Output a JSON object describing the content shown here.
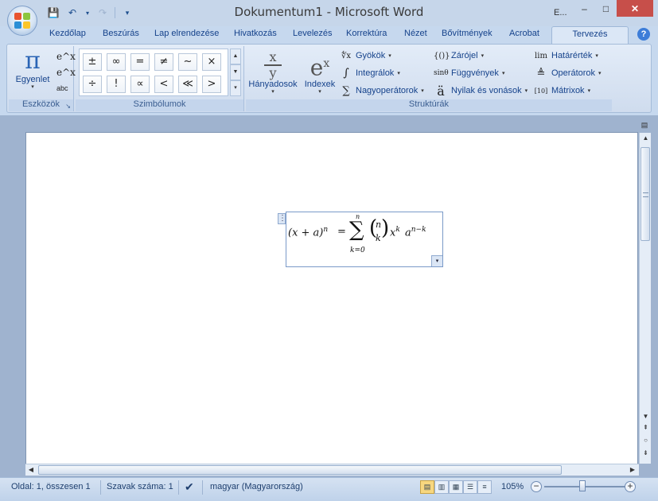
{
  "window": {
    "title": "Dokumentum1 - Microsoft Word",
    "user": "E...",
    "minimize": "–",
    "maximize": "□",
    "close": "✕"
  },
  "qat": {
    "save": "💾",
    "undo": "↶",
    "undo_dd": "▾",
    "redo": "↷",
    "customize": "▾"
  },
  "tabs": [
    "Kezdőlap",
    "Beszúrás",
    "Lap elrendezése",
    "Hivatkozás",
    "Levelezés",
    "Korrektúra",
    "Nézet",
    "Bővítmények",
    "Acrobat",
    "Tervezés"
  ],
  "active_tab": "Tervezés",
  "help": "?",
  "ribbon": {
    "eszkozok": {
      "label": "Eszközök",
      "launcher": "↘",
      "equation_glyph": "π",
      "equation_label": "Egyenlet",
      "equation_caret": "▾",
      "small_icons": [
        "e^x",
        "e^x",
        "abc"
      ]
    },
    "szimbolumok": {
      "label": "Szimbólumok",
      "row1": [
        "±",
        "∞",
        "=",
        "≠",
        "~",
        "×"
      ],
      "row2": [
        "÷",
        "!",
        "∝",
        "<",
        "≪",
        ">"
      ],
      "scroll": [
        "▲",
        "▼",
        "▾"
      ]
    },
    "strukturak": {
      "label": "Struktúrák",
      "hanyadosok_glyph_num": "x",
      "hanyadosok_glyph_den": "y",
      "hanyadosok_label": "Hányadosok",
      "indexek_glyph": "e",
      "indexek_sup": "x",
      "indexek_label": "Indexek",
      "col1": [
        {
          "icon": "∜x",
          "label": "Gyökök"
        },
        {
          "icon": "∫",
          "label": "Integrálok"
        },
        {
          "icon": "∑",
          "label": "Nagyoperátorok"
        }
      ],
      "col2": [
        {
          "icon": "{()}",
          "label": "Zárójel"
        },
        {
          "icon": "sinθ",
          "label": "Függvények"
        },
        {
          "icon": "ä",
          "label": "Nyilak és vonások"
        }
      ],
      "col3": [
        {
          "icon": "lim",
          "label": "Határérték"
        },
        {
          "icon": "≜",
          "label": "Operátorok"
        },
        {
          "icon": "[10]",
          "label": "Mátrixok"
        }
      ]
    }
  },
  "equation": {
    "lhs": "(x + a)",
    "lhs_exp": "n",
    "eq": "=",
    "sum_top": "n",
    "sum_symbol": "∑",
    "sum_bottom": "k=0",
    "binom_top": "n",
    "binom_bottom": "k",
    "term_x": "x",
    "term_x_exp": "k",
    "term_a": "a",
    "term_a_exp": "n−k",
    "handle": "⋮",
    "options": "▾"
  },
  "statusbar": {
    "page": "Oldal: 1, összesen 1",
    "words": "Szavak száma: 1",
    "language": "magyar (Magyarország)",
    "zoom": "105%"
  }
}
